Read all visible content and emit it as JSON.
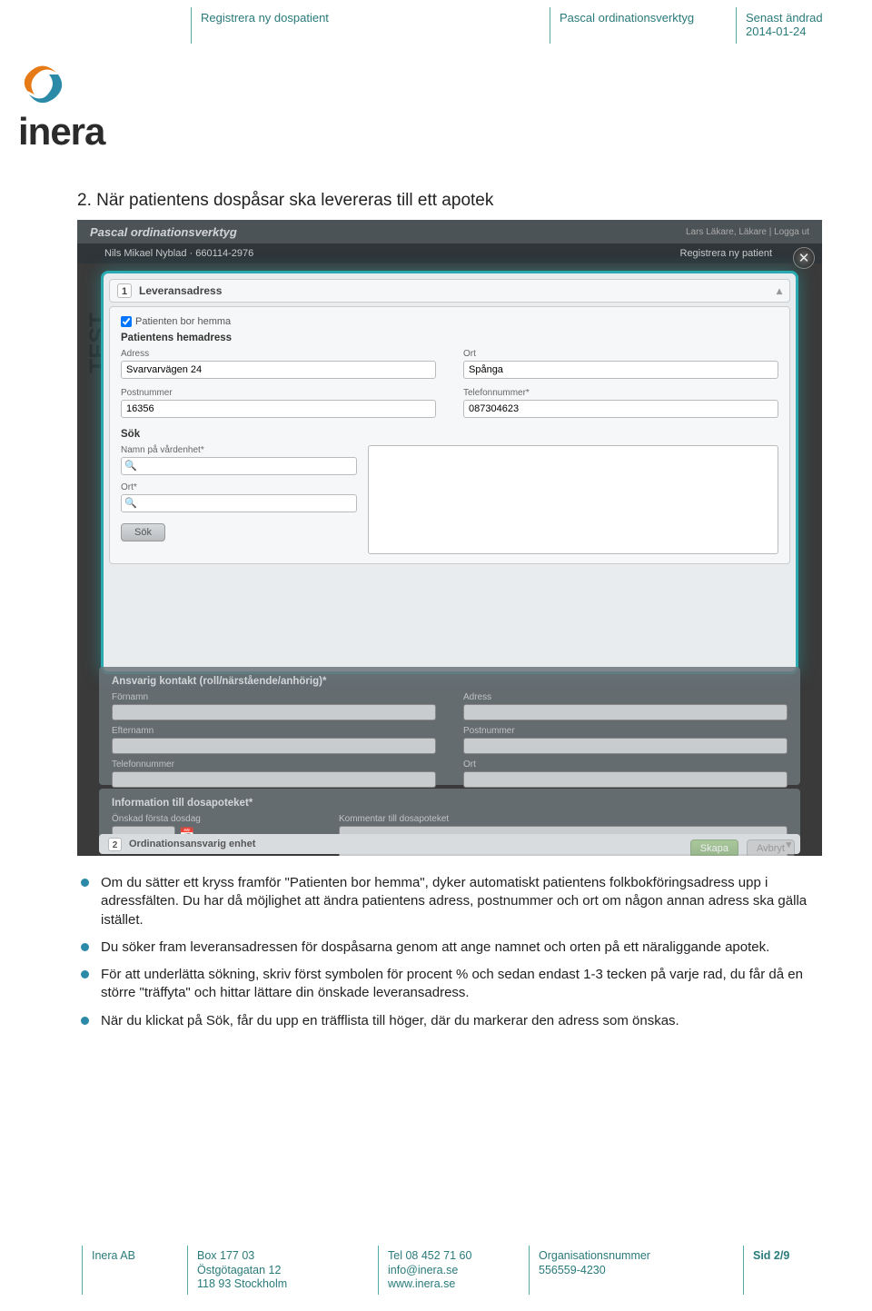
{
  "header": {
    "col1": "Registrera ny dospatient",
    "col2": "Pascal ordinationsverktyg",
    "col3a": "Senast ändrad",
    "col3b": "2014-01-24"
  },
  "logo_text": "inera",
  "section_title": "2. När patientens dospåsar ska levereras till ett apotek",
  "app": {
    "brand": "Pascal ordinationsverktyg",
    "user_info": "Lars Läkare, Läkare | Logga ut",
    "patient_bar_left": "Nils Mikael Nyblad · 660114-2976",
    "patient_bar_right": "Registrera ny patient",
    "step1_num": "1",
    "step1_title": "Leveransadress",
    "checkbox_label": "Patienten bor hemma",
    "home_title": "Patientens hemadress",
    "fields": {
      "adress_lbl": "Adress",
      "adress_val": "Svarvarvägen 24",
      "ort_lbl": "Ort",
      "ort_val": "Spånga",
      "postnr_lbl": "Postnummer",
      "postnr_val": "16356",
      "tel_lbl": "Telefonnummer*",
      "tel_val": "087304623"
    },
    "search": {
      "title": "Sök",
      "namn_lbl": "Namn på vårdenhet*",
      "ort_lbl": "Ort*",
      "btn": "Sök"
    },
    "dim": {
      "contact_title": "Ansvarig kontakt (roll/närstående/anhörig)*",
      "fornamn": "Förnamn",
      "adress": "Adress",
      "efternamn": "Efternamn",
      "postnr": "Postnummer",
      "tel": "Telefonnummer",
      "ort": "Ort",
      "info_title": "Information till dosapoteket*",
      "onskad": "Önskad första dosdag",
      "kommentar": "Kommentar till dosapoteket"
    },
    "step2_num": "2",
    "step2_title": "Ordinationsansvarig enhet",
    "skapa": "Skapa",
    "avbryt": "Avbryt"
  },
  "bullets": [
    "Om du sätter ett kryss framför \"Patienten bor hemma\", dyker automatiskt patientens folkbokföringsadress upp i adressfälten. Du har då möjlighet att ändra patientens adress, postnummer och ort om någon annan adress ska gälla istället.",
    "Du söker fram leveransadressen för dospåsarna genom att ange namnet och orten på ett näraliggande apotek.",
    "För att underlätta sökning, skriv först symbolen för procent % och sedan endast 1-3 tecken på varje rad, du får då en större \"träffyta\" och hittar lättare din önskade leveransadress.",
    "När du klickat på Sök, får du upp en träfflista till höger, där du markerar den adress som önskas."
  ],
  "footer": {
    "company": "Inera AB",
    "addr1": "Box 177 03",
    "addr2": "Östgötagatan 12",
    "addr3": "118 93 Stockholm",
    "tel": "Tel 08 452 71 60",
    "email": "info@inera.se",
    "web": "www.inera.se",
    "org_lbl": "Organisationsnummer",
    "org_val": "556559-4230",
    "page": "Sid 2/9"
  }
}
